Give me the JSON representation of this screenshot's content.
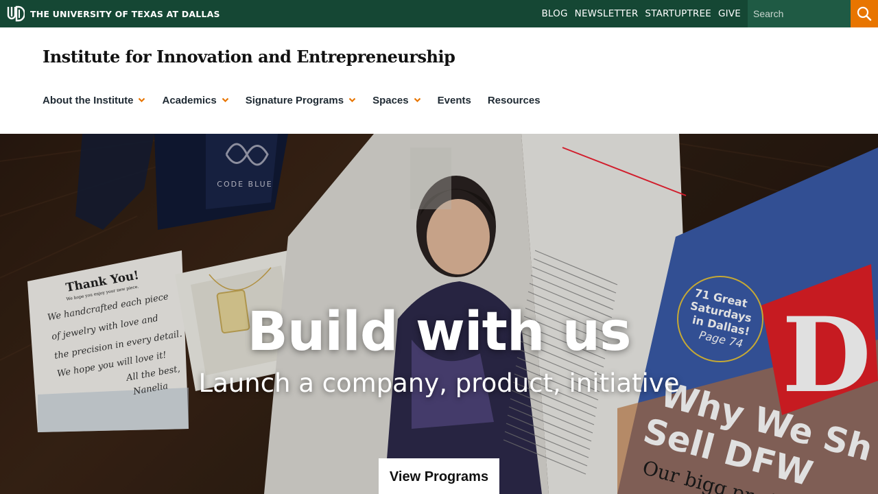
{
  "topbar": {
    "university_name": "THE UNIVERSITY OF TEXAS AT DALLAS",
    "links": [
      "BLOG",
      "NEWSLETTER",
      "STARTUPTREE",
      "GIVE"
    ],
    "search_placeholder": "Search",
    "colors": {
      "bar": "#154734",
      "search_button": "#e87500"
    }
  },
  "header": {
    "site_title": "Institute for Innovation and Entrepreneurship"
  },
  "nav": {
    "items": [
      {
        "label": "About the Institute",
        "has_dropdown": true
      },
      {
        "label": "Academics",
        "has_dropdown": true
      },
      {
        "label": "Signature Programs",
        "has_dropdown": true
      },
      {
        "label": "Spaces",
        "has_dropdown": true
      },
      {
        "label": "Events",
        "has_dropdown": false
      },
      {
        "label": "Resources",
        "has_dropdown": false
      }
    ],
    "chevron_color": "#e87500"
  },
  "hero": {
    "title": "Build with us",
    "subtitle": "Launch a company, product, initiative",
    "button_label": "View Programs",
    "photo_text": {
      "box_label": "CODE BLUE",
      "card_heading": "Thank You!",
      "card_subheading": "We hope you enjoy your new piece.",
      "card_lines": [
        "We handcrafted each piece",
        "of jewelry with love and",
        "the precision in every detail.",
        "We hope you will love it!",
        "All the best,",
        "Nanelia"
      ],
      "magazine_badge": [
        "71 Great",
        "Saturdays",
        "in Dallas!",
        "Page 74"
      ],
      "magazine_letter": "D",
      "magazine_headline": [
        "Why We Sh",
        "Sell DFW"
      ],
      "magazine_sub": "Our bigg produ"
    }
  }
}
